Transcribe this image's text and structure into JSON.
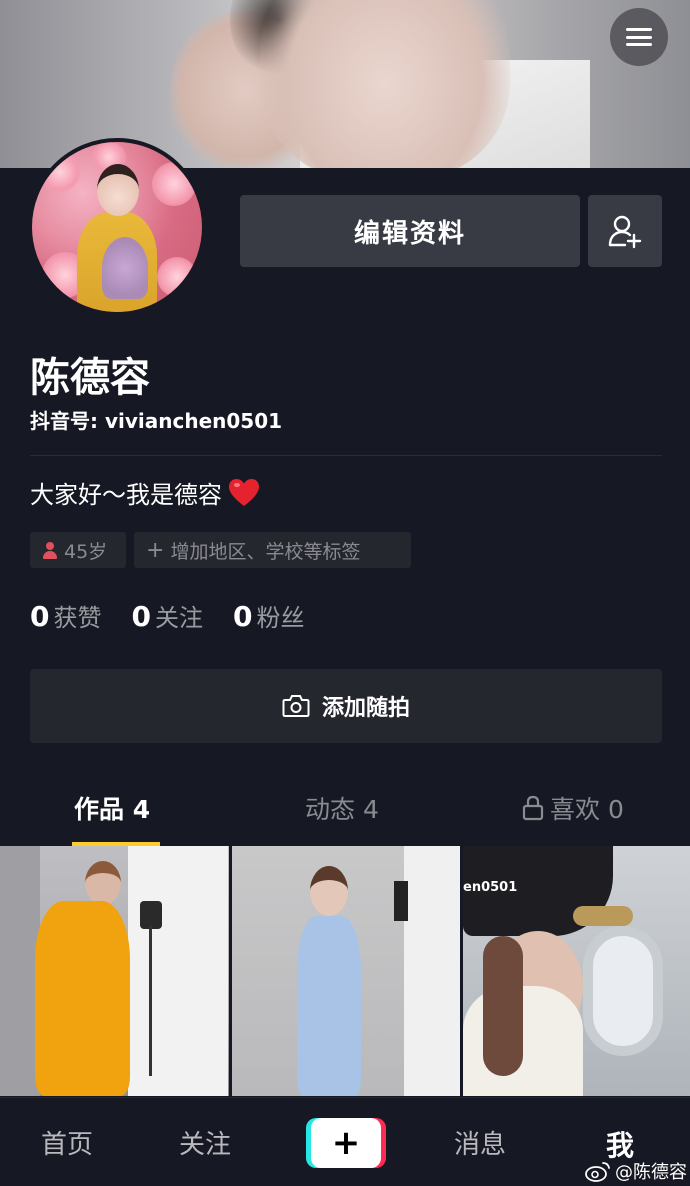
{
  "cover": {
    "menu_icon": "hamburger-icon"
  },
  "profile": {
    "edit_label": "编辑资料",
    "add_friend_icon": "add-friend-icon",
    "name": "陈德容",
    "douyin_id": "抖音号: vivianchen0501",
    "bio": "大家好～我是德容",
    "bio_emoji": "heart-emoji",
    "tags": {
      "age": "45岁",
      "add_hint": "增加地区、学校等标签"
    },
    "stats": [
      {
        "num": "0",
        "label": "获赞"
      },
      {
        "num": "0",
        "label": "关注"
      },
      {
        "num": "0",
        "label": "粉丝"
      }
    ],
    "snap_label": "添加随拍"
  },
  "tabs": [
    {
      "label": "作品 4",
      "active": true
    },
    {
      "label": "动态 4",
      "active": false
    },
    {
      "label": "喜欢 0",
      "active": false,
      "icon": "lock-icon"
    }
  ],
  "thumbnails": [
    {
      "overlay_text": ""
    },
    {
      "overlay_text": ""
    },
    {
      "overlay_text": "en0501"
    }
  ],
  "nav": {
    "home": "首页",
    "follow": "关注",
    "create": "+",
    "messages": "消息",
    "me": "我"
  },
  "watermark": "@陈德容",
  "colors": {
    "background": "#161823",
    "button": "#393b44",
    "tab_underline": "#facd2d",
    "create_cyan": "#26e6e6",
    "create_red": "#fe2c55"
  }
}
